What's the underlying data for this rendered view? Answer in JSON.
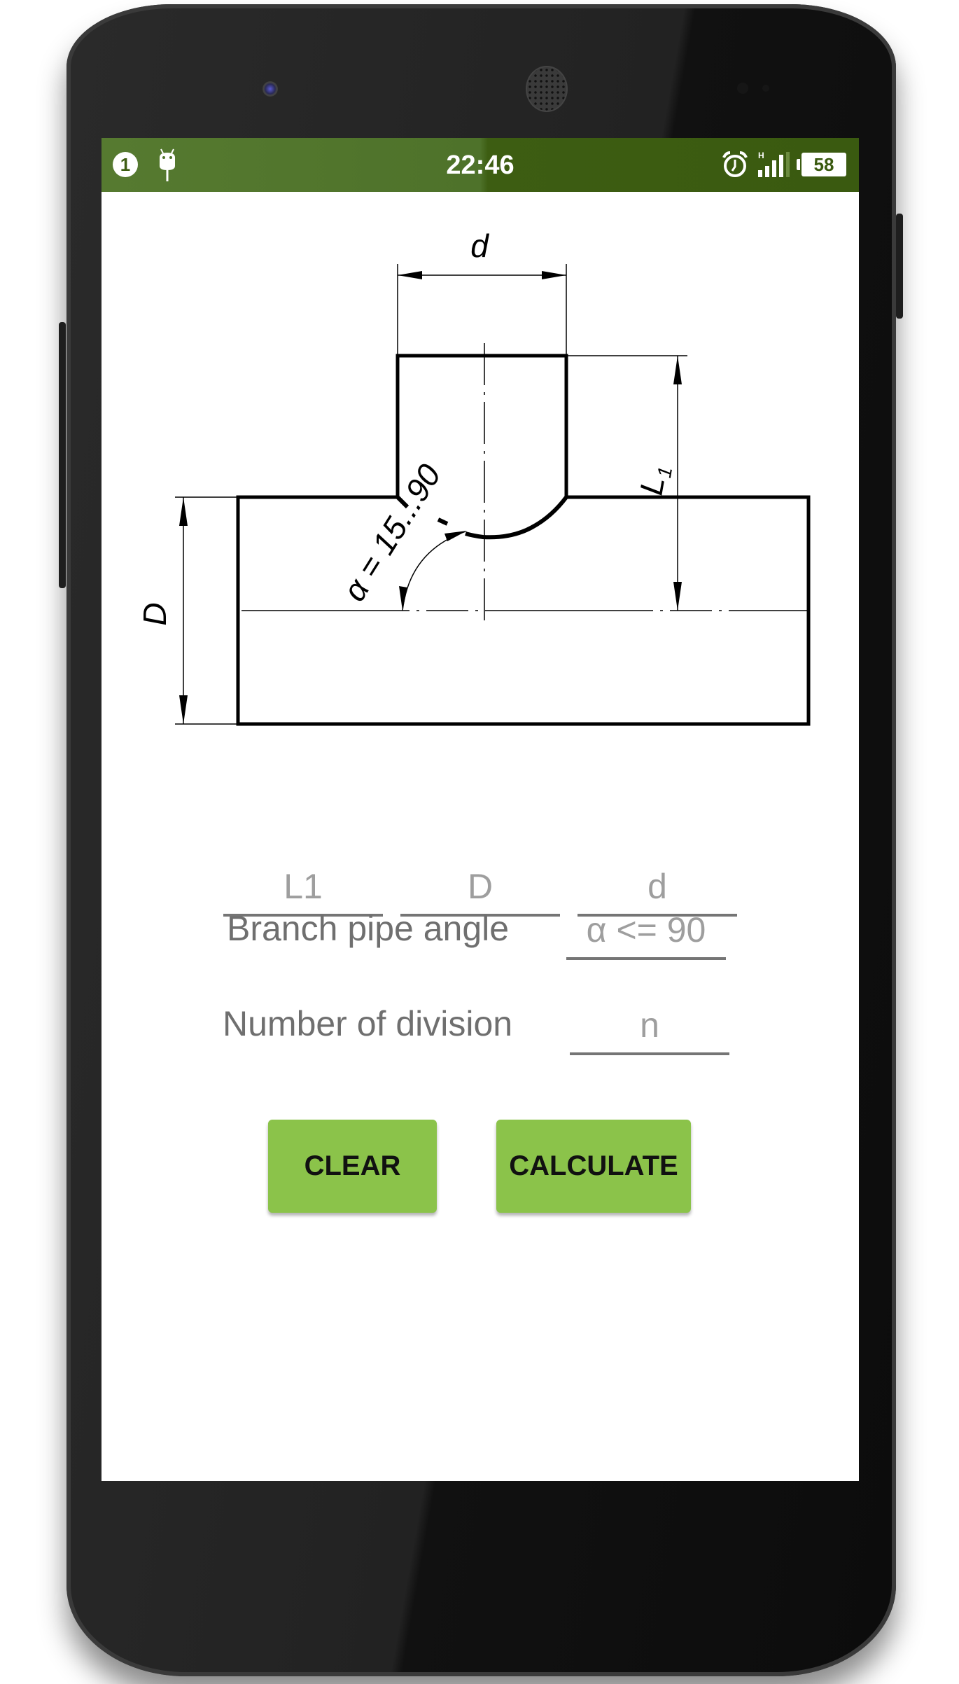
{
  "status_bar": {
    "time": "22:46",
    "notification_count": "1",
    "network_type": "H",
    "battery_level": "58",
    "icons": [
      "notification-count-icon",
      "android-debug-icon",
      "alarm-icon",
      "signal-icon",
      "battery-icon"
    ]
  },
  "diagram": {
    "label_d": "d",
    "label_D": "D",
    "label_L1": "L",
    "label_L1_sub": "1",
    "label_alpha": "α = 15...90"
  },
  "form": {
    "dimension_fields": [
      {
        "name": "L1",
        "placeholder": "L1",
        "value": ""
      },
      {
        "name": "D",
        "placeholder": "D",
        "value": ""
      },
      {
        "name": "d",
        "placeholder": "d",
        "value": ""
      }
    ],
    "angle_label": "Branch pipe angle",
    "angle_placeholder": "α <= 90",
    "angle_value": "",
    "division_label": "Number of division",
    "division_placeholder": "n",
    "division_value": ""
  },
  "buttons": {
    "clear": "CLEAR",
    "calculate": "CALCULATE"
  },
  "colors": {
    "status_bar": "#3d5d12",
    "button": "#8bc34a",
    "placeholder": "#9e9e9e",
    "label": "#6f6f6f"
  }
}
